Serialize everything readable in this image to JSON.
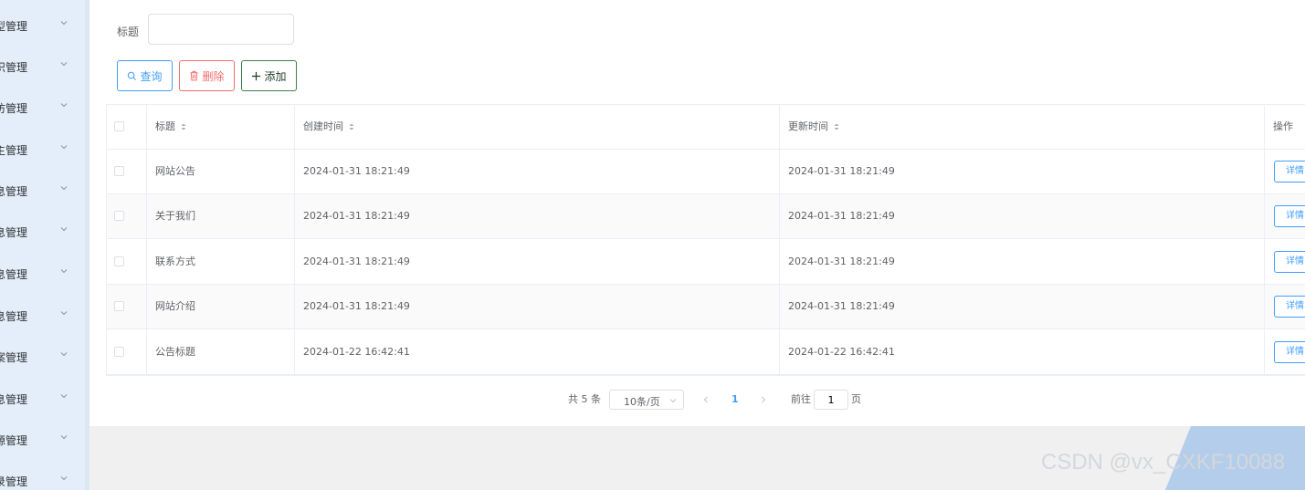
{
  "sidebar": {
    "items": [
      {
        "label": "型管理"
      },
      {
        "label": "识管理"
      },
      {
        "label": "访管理"
      },
      {
        "label": "主管理"
      },
      {
        "label": "息管理"
      },
      {
        "label": "息管理"
      },
      {
        "label": "息管理"
      },
      {
        "label": "息管理"
      },
      {
        "label": "案管理"
      },
      {
        "label": "息管理"
      },
      {
        "label": "源管理"
      },
      {
        "label": "录管理"
      }
    ]
  },
  "search": {
    "label": "标题",
    "value": "",
    "placeholder": ""
  },
  "toolbar": {
    "query_label": "查询",
    "delete_label": "删除",
    "add_label": "添加"
  },
  "table": {
    "columns": [
      "标题",
      "创建时间",
      "更新时间",
      "操作"
    ],
    "rows": [
      {
        "title": "网站公告",
        "created": "2024-01-31 18:21:49",
        "updated": "2024-01-31 18:21:49",
        "action": "详情"
      },
      {
        "title": "关于我们",
        "created": "2024-01-31 18:21:49",
        "updated": "2024-01-31 18:21:49",
        "action": "详情"
      },
      {
        "title": "联系方式",
        "created": "2024-01-31 18:21:49",
        "updated": "2024-01-31 18:21:49",
        "action": "详情"
      },
      {
        "title": "网站介绍",
        "created": "2024-01-31 18:21:49",
        "updated": "2024-01-31 18:21:49",
        "action": "详情"
      },
      {
        "title": "公告标题",
        "created": "2024-01-22 16:42:41",
        "updated": "2024-01-22 16:42:41",
        "action": "详情"
      }
    ]
  },
  "pagination": {
    "total": "共 5 条",
    "page_size": "10条/页",
    "current_page": "1",
    "goto_prefix": "前往",
    "goto_value": "1",
    "goto_suffix": "页"
  },
  "watermark": "CSDN @vx_CXKF10088",
  "colors": {
    "primary": "#409eff",
    "danger": "#f56c6c",
    "add_border": "#3d7d4a",
    "sidebar_bg": "#e3eefa"
  }
}
